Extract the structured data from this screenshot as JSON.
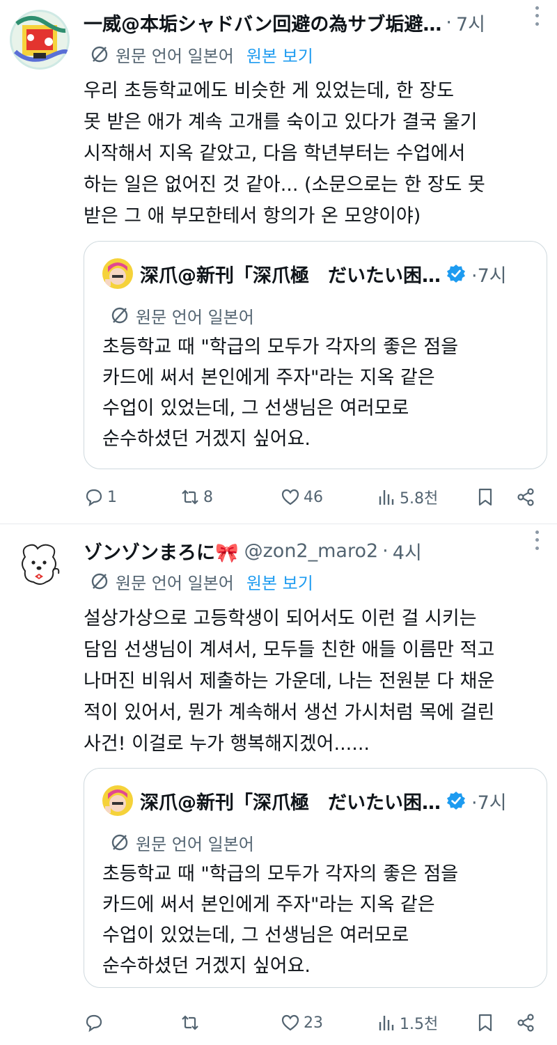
{
  "posts": [
    {
      "author": "一威@本垢シャドバン回避の為サブ垢避…",
      "handle": "",
      "time": "7시",
      "translation_note": "원문 언어 일본어",
      "show_original": "원본 보기",
      "text_lines": [
        "우리 초등학교에도 비슷한 게 있었는데, 한 장도",
        "못 받은 애가 계속 고개를 숙이고 있다가 결국 울기",
        "시작해서 지옥 같았고, 다음 학년부터는 수업에서",
        "하는 일은 없어진 것 같아... (소문으로는 한 장도 못",
        "받은 그 애 부모한테서 항의가 온 모양이야)"
      ],
      "quote": {
        "author": "深爪@新刊「深爪極　だいたい困…",
        "time": "7시",
        "translation_note": "원문 언어 일본어",
        "text_lines": [
          "초등학교 때 \"학급의 모두가 각자의 좋은 점을",
          "카드에 써서 본인에게 주자\"라는 지옥 같은",
          "수업이 있었는데, 그 선생님은 여러모로",
          "순수하셨던 거겠지 싶어요."
        ]
      },
      "actions": {
        "replies": "1",
        "reposts": "8",
        "likes": "46",
        "views": "5.8천"
      }
    },
    {
      "author": "ゾンゾンまろに🎀",
      "handle": "@zon2_maro2",
      "time": "4시",
      "translation_note": "원문 언어 일본어",
      "show_original": "원본 보기",
      "text_lines": [
        "설상가상으로 고등학생이 되어서도 이런 걸 시키는",
        "담임 선생님이 계셔서, 모두들 친한 애들 이름만 적고",
        "나머진 비워서 제출하는 가운데, 나는 전원분 다 채운",
        "적이 있어서, 뭔가 계속해서 생선 가시처럼 목에 걸린",
        "사건! 이걸로 누가 행복해지겠어......"
      ],
      "quote": {
        "author": "深爪@新刊「深爪極　だいたい困…",
        "time": "7시",
        "translation_note": "원문 언어 일본어",
        "text_lines": [
          "초등학교 때 \"학급의 모두가 각자의 좋은 점을",
          "카드에 써서 본인에게 주자\"라는 지옥 같은",
          "수업이 있었는데, 그 선생님은 여러모로",
          "순수하셨던 거겠지 싶어요."
        ]
      },
      "actions": {
        "replies": "",
        "reposts": "",
        "likes": "23",
        "views": "1.5천"
      }
    }
  ],
  "separator": "·",
  "icons": {
    "more": "more-vertical-icon",
    "translate": "translate-globe-icon",
    "verified": "verified-badge-icon",
    "reply": "reply-icon",
    "repost": "repost-icon",
    "like": "heart-icon",
    "views": "views-icon",
    "bookmark": "bookmark-icon",
    "share": "share-icon"
  },
  "colors": {
    "text": "#0f1419",
    "muted": "#536471",
    "link": "#1d9bf0",
    "border": "#cfd9de",
    "verified": "#1d9bf0"
  }
}
